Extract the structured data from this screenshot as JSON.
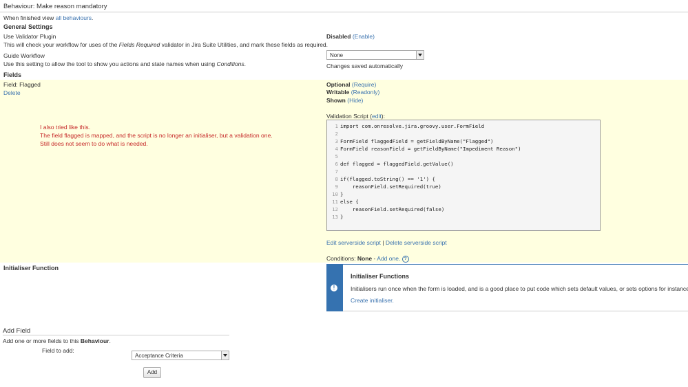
{
  "header": {
    "title": "Behaviour: Make reason mandatory"
  },
  "intro": {
    "prefix": "When finished view ",
    "link": "all behaviours",
    "suffix": "."
  },
  "general_settings": {
    "heading": "General Settings",
    "validator": {
      "label": "Use Validator Plugin",
      "desc_prefix": "This will check your workflow for uses of the ",
      "desc_italic": "Fields Required",
      "desc_suffix": " validator in Jira Suite Utilities, and mark these fields as required.",
      "status": "Disabled",
      "action": "(Enable)"
    },
    "guide": {
      "label": "Guide Workflow",
      "desc_prefix": "Use this setting to allow the tool to show you actions and state names when using ",
      "desc_italic": "Conditions",
      "desc_suffix": ".",
      "select_value": "None",
      "saved_note": "Changes saved automatically"
    }
  },
  "fields": {
    "heading": "Fields",
    "field_label": "Field: Flagged",
    "delete": "Delete",
    "optional": "Optional",
    "require": "(Require)",
    "writable": "Writable",
    "readonly": "(Readonly)",
    "shown": "Shown",
    "hide": "(Hide)",
    "validation_label": "Validation Script",
    "edit_open": "(",
    "edit_link": "edit",
    "edit_close": "):",
    "code_lines": [
      "import com.onresolve.jira.groovy.user.FormField",
      "",
      "FormField flaggedField = getFieldByName(\"Flagged\")",
      "FormField reasonField = getFieldByName(\"Impediment Reason\")",
      "",
      "def flagged = flaggedField.getValue()",
      "",
      "if(flagged.toString() == '1') {",
      "    reasonField.setRequired(true)",
      "}",
      "else {",
      "    reasonField.setRequired(false)",
      "}"
    ],
    "line_numbers": [
      "1",
      "2",
      "3",
      "4",
      "5",
      "6",
      "7",
      "8",
      "9",
      "10",
      "11",
      "12",
      "13"
    ],
    "edit_serverside": "Edit serverside script",
    "separator": "|",
    "delete_serverside": "Delete serverside script",
    "conditions_label": "Conditions:",
    "conditions_value": "None",
    "conditions_dash": "-",
    "add_one": "Add one.",
    "help_glyph": "?",
    "note_lines": [
      "I also tried like this.",
      "The field flagged is mapped, and the script is no longer an initialiser, but a validation one.",
      "Still does not seem to do what is needed."
    ]
  },
  "initialiser": {
    "heading": "Initialiser Function",
    "panel_title": "Initialiser Functions",
    "panel_text": "Initialisers run once when the form is loaded, and is a good place to put code which sets default values, or sets options for instance.",
    "create_link": "Create initialiser.",
    "icon_glyph": "!"
  },
  "add_field": {
    "heading": "Add Field",
    "desc_prefix": "Add one or more fields to this ",
    "desc_bold": "Behaviour",
    "desc_suffix": ".",
    "field_label": "Field to add:",
    "select_value": "Acceptance Criteria",
    "button": "Add"
  }
}
